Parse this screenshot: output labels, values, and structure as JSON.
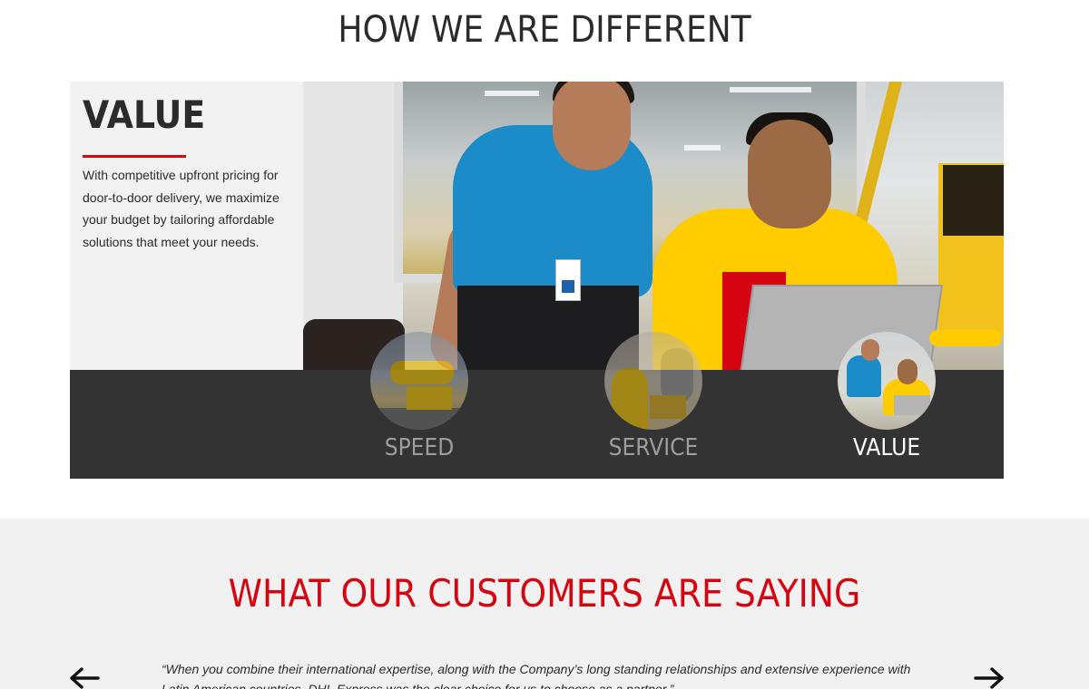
{
  "differences": {
    "section_title": "HOW WE ARE DIFFERENT",
    "panel": {
      "heading": "VALUE",
      "body": "With competitive upfront pricing for door-to-door delivery, we maximize your budget by tailoring affordable solutions that meet your needs."
    },
    "tabs": [
      {
        "label": "SPEED",
        "icon": "plane-and-van-thumbnail",
        "active": false
      },
      {
        "label": "SERVICE",
        "icon": "courier-delivery-thumbnail",
        "active": false
      },
      {
        "label": "VALUE",
        "icon": "team-at-laptop-thumbnail",
        "active": true
      }
    ]
  },
  "testimonials": {
    "section_title": "WHAT OUR CUSTOMERS ARE SAYING",
    "quote": "“When you combine their international expertise, along with the Company’s long standing relationships and extensive experience with Latin American countries, DHL Express was the clear choice for us to choose as a partner.”",
    "prev_icon": "arrow-left-icon",
    "next_icon": "arrow-right-icon"
  },
  "colors": {
    "brand_red": "#d40511",
    "brand_yellow": "#ffcc00",
    "tab_bar": "#333333",
    "panel_bg": "#f2f2f2",
    "testimonials_bg": "#f1f1f1"
  }
}
